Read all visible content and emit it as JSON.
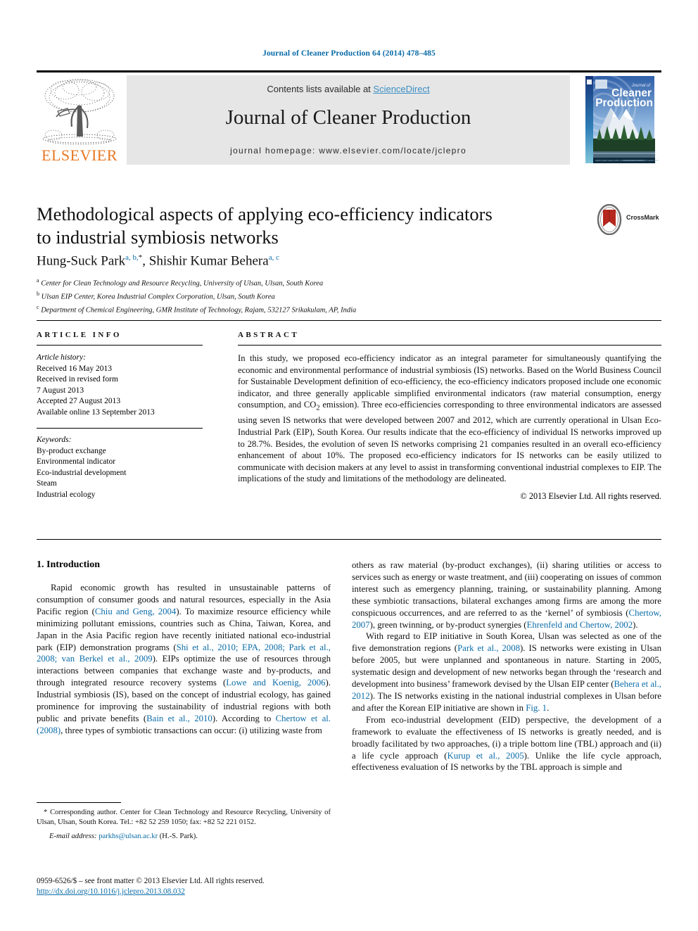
{
  "running_head": "Journal of Cleaner Production 64 (2014) 478–485",
  "masthead": {
    "contents_prefix": "Contents lists available at ",
    "sciencedirect": "ScienceDirect",
    "journal_title": "Journal of Cleaner Production",
    "homepage": "journal homepage: www.elsevier.com/locate/jclepro",
    "publisher_wordmark": "ELSEVIER",
    "cover_title_small": "Journal of",
    "cover_title_line1": "Cleaner",
    "cover_title_line2": "Production",
    "accent_blue": "#0b6ca8",
    "elsevier_orange": "#E87722"
  },
  "crossmark": {
    "label": "CrossMark"
  },
  "article": {
    "title": "Methodological aspects of applying eco-efficiency indicators to industrial symbiosis networks",
    "title_line1": "Methodological aspects of applying eco-efficiency indicators",
    "title_line2": "to industrial symbiosis networks",
    "authors_plain": "Hung-Suck Park a, b, *, Shishir Kumar Behera a, c",
    "author1_name": "Hung-Suck Park",
    "author1_marks": "a, b,",
    "author1_star": "*",
    "author_sep": ", ",
    "author2_name": "Shishir Kumar Behera",
    "author2_marks": "a, c",
    "affiliations": [
      {
        "mark": "a",
        "text": "Center for Clean Technology and Resource Recycling, University of Ulsan, Ulsan, South Korea"
      },
      {
        "mark": "b",
        "text": "Ulsan EIP Center, Korea Industrial Complex Corporation, Ulsan, South Korea"
      },
      {
        "mark": "c",
        "text": "Department of Chemical Engineering, GMR Institute of Technology, Rajam, 532127 Srikakulam, AP, India"
      }
    ]
  },
  "article_info": {
    "heading": "ARTICLE INFO",
    "history_label": "Article history:",
    "history": [
      "Received 16 May 2013",
      "Received in revised form",
      "7 August 2013",
      "Accepted 27 August 2013",
      "Available online 13 September 2013"
    ],
    "keywords_label": "Keywords:",
    "keywords": [
      "By-product exchange",
      "Environmental indicator",
      "Eco-industrial development",
      "Steam",
      "Industrial ecology"
    ]
  },
  "abstract": {
    "heading": "ABSTRACT",
    "text_part1": "In this study, we proposed eco-efficiency indicator as an integral parameter for simultaneously quantifying the economic and environmental performance of industrial symbiosis (IS) networks. Based on the World Business Council for Sustainable Development definition of eco-efficiency, the eco-efficiency indicators proposed include one economic indicator, and three generally applicable simplified environmental indicators (raw material consumption, energy consumption, and CO",
    "co2_sub": "2",
    "text_part2": " emission). Three eco-efficiencies corresponding to three environmental indicators are assessed using seven IS networks that were developed between 2007 and 2012, which are currently operational in Ulsan Eco-Industrial Park (EIP), South Korea. Our results indicate that the eco-efficiency of individual IS networks improved up to 28.7%. Besides, the evolution of seven IS networks comprising 21 companies resulted in an overall eco-efficiency enhancement of about 10%. The proposed eco-efficiency indicators for IS networks can be easily utilized to communicate with decision makers at any level to assist in transforming conventional industrial complexes to EIP. The implications of the study and limitations of the methodology are delineated.",
    "copyright": "© 2013 Elsevier Ltd. All rights reserved."
  },
  "body": {
    "section_number_title": "1. Introduction",
    "left_p1_a": "Rapid economic growth has resulted in unsustainable patterns of consumption of consumer goods and natural resources, especially in the Asia Pacific region (",
    "left_ref1": "Chiu and Geng, 2004",
    "left_p1_b": "). To maximize resource efficiency while minimizing pollutant emissions, countries such as China, Taiwan, Korea, and Japan in the Asia Pacific region have recently initiated national eco-industrial park (EIP) demonstration programs (",
    "left_ref2": "Shi et al., 2010; EPA, 2008; Park et al., 2008; van Berkel et al., 2009",
    "left_p1_c": "). EIPs optimize the use of resources through interactions between companies that exchange waste and by-products, and through integrated resource recovery systems (",
    "left_ref3": "Lowe and Koenig, 2006",
    "left_p1_d": "). Industrial symbiosis (IS), based on the concept of industrial ecology, has gained prominence for improving the sustainability of industrial regions with both public and private benefits (",
    "left_ref4": "Bain et al., 2010",
    "left_p1_e": "). According to ",
    "left_ref5": "Chertow et al. (2008)",
    "left_p1_f": ", three types of symbiotic transactions can occur: (i) utilizing waste from",
    "right_p1_a": "others as raw material (by-product exchanges), (ii) sharing utilities or access to services such as energy or waste treatment, and (iii) cooperating on issues of common interest such as emergency planning, training, or sustainability planning. Among these symbiotic transactions, bilateral exchanges among firms are among the more conspicuous occurrences, and are referred to as the ‘kernel’ of symbiosis (",
    "right_ref1": "Chertow, 2007",
    "right_p1_b": "), green twinning, or by-product synergies (",
    "right_ref2": "Ehrenfeld and Chertow, 2002",
    "right_p1_c": ").",
    "right_p2_a": "With regard to EIP initiative in South Korea, Ulsan was selected as one of the five demonstration regions (",
    "right_ref3": "Park et al., 2008",
    "right_p2_b": "). IS networks were existing in Ulsan before 2005, but were unplanned and spontaneous in nature. Starting in 2005, systematic design and development of new networks began through the ‘research and development into business’ framework devised by the Ulsan EIP center (",
    "right_ref4": "Behera et al., 2012",
    "right_p2_c": "). The IS networks existing in the national industrial complexes in Ulsan before and after the Korean EIP initiative are shown in ",
    "right_ref5": "Fig. 1",
    "right_p2_d": ".",
    "right_p3_a": "From eco-industrial development (EID) perspective, the development of a framework to evaluate the effectiveness of IS networks is greatly needed, and is broadly facilitated by two approaches, (i) a triple bottom line (TBL) approach and (ii) a life cycle approach (",
    "right_ref6": "Kurup et al., 2005",
    "right_p3_b": "). Unlike the life cycle approach, effectiveness evaluation of IS networks by the TBL approach is simple and"
  },
  "footnotes": {
    "corresponding": "* Corresponding author. Center for Clean Technology and Resource Recycling, University of Ulsan, Ulsan, South Korea. Tel.: +82 52 259 1050; fax: +82 52 221 0152.",
    "email_label": "E-mail address:",
    "email": "parkhs@ulsan.ac.kr",
    "email_suffix": "(H.-S. Park)."
  },
  "imprint": {
    "issn_line": "0959-6526/$ – see front matter © 2013 Elsevier Ltd. All rights reserved.",
    "doi": "http://dx.doi.org/10.1016/j.jclepro.2013.08.032"
  }
}
